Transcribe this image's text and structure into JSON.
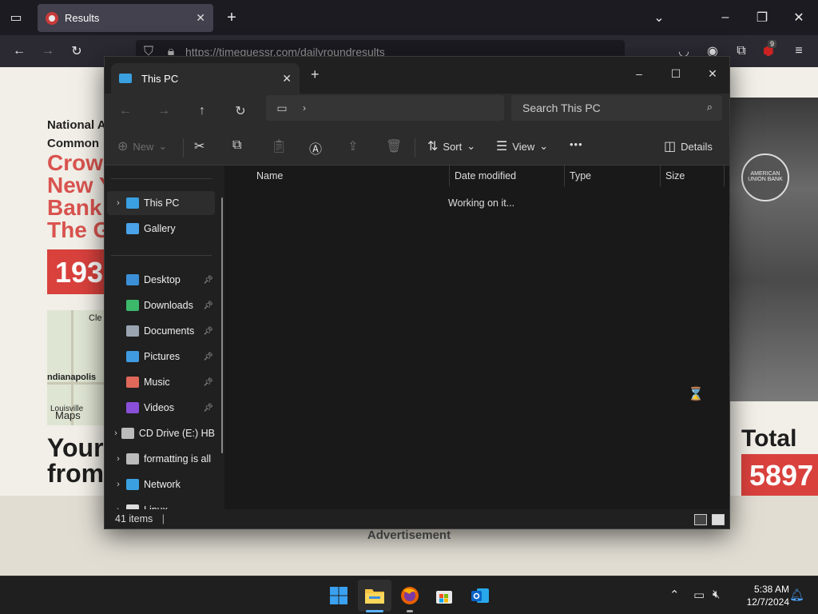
{
  "browser": {
    "tab_title": "Results",
    "tab_close": "✕",
    "new_tab": "+",
    "url": "https://timeguessr.com/dailyroundresults",
    "extension_badge": "9"
  },
  "webpage": {
    "top_line1": "National A",
    "top_line2": "Common",
    "title_lines": [
      "Crow",
      "New Y",
      "Bank",
      "The G"
    ],
    "year": "193",
    "map_labels": {
      "cle": "Cle",
      "indianapolis": "ndianapolis",
      "louisville": "Louisville",
      "maps": "Maps"
    },
    "your_line1": "Your",
    "your_line2": "from",
    "total_label": "Total",
    "total_value": "5897",
    "advertisement": "Advertisement",
    "photo_sign": "AMERICAN UNION BANK"
  },
  "explorer": {
    "tab_title": "This PC",
    "tab_close": "✕",
    "new_tab": "+",
    "search_placeholder": "Search This PC",
    "toolbar": {
      "new_label": "New",
      "sort_label": "Sort",
      "view_label": "View",
      "more_label": "•••",
      "details_label": "Details"
    },
    "nav_items": [
      {
        "label": "This PC",
        "icon": "this-pc-icon",
        "color": "#3aa0e0",
        "chevron": true,
        "pinned": false,
        "selected": true
      },
      {
        "label": "Gallery",
        "icon": "gallery-icon",
        "color": "#4aa3e8",
        "chevron": false,
        "pinned": false,
        "selected": false
      },
      {
        "label": "Desktop",
        "icon": "desktop-icon",
        "color": "#3b8fd6",
        "chevron": false,
        "pinned": true,
        "selected": false
      },
      {
        "label": "Downloads",
        "icon": "downloads-icon",
        "color": "#3cb86b",
        "chevron": false,
        "pinned": true,
        "selected": false
      },
      {
        "label": "Documents",
        "icon": "documents-icon",
        "color": "#9aa4b1",
        "chevron": false,
        "pinned": true,
        "selected": false
      },
      {
        "label": "Pictures",
        "icon": "pictures-icon",
        "color": "#3f9ae0",
        "chevron": false,
        "pinned": true,
        "selected": false
      },
      {
        "label": "Music",
        "icon": "music-icon",
        "color": "#e0685a",
        "chevron": false,
        "pinned": true,
        "selected": false
      },
      {
        "label": "Videos",
        "icon": "videos-icon",
        "color": "#8a4fd8",
        "chevron": false,
        "pinned": true,
        "selected": false
      },
      {
        "label": "CD Drive (E:) HB",
        "icon": "cd-drive-icon",
        "color": "#bbbbbb",
        "chevron": true,
        "pinned": false,
        "selected": false
      },
      {
        "label": "formatting is all",
        "icon": "drive-icon",
        "color": "#bbbbbb",
        "chevron": true,
        "pinned": false,
        "selected": false
      },
      {
        "label": "Network",
        "icon": "network-icon",
        "color": "#3aa0e0",
        "chevron": true,
        "pinned": false,
        "selected": false
      },
      {
        "label": "Linux",
        "icon": "linux-icon",
        "color": "#dddddd",
        "chevron": true,
        "pinned": false,
        "selected": false
      }
    ],
    "columns": [
      "Name",
      "Date modified",
      "Type",
      "Size"
    ],
    "loading_text": "Working on it...",
    "status_items": "41 items"
  },
  "taskbar": {
    "time": "5:38 AM",
    "date": "12/7/2024"
  }
}
